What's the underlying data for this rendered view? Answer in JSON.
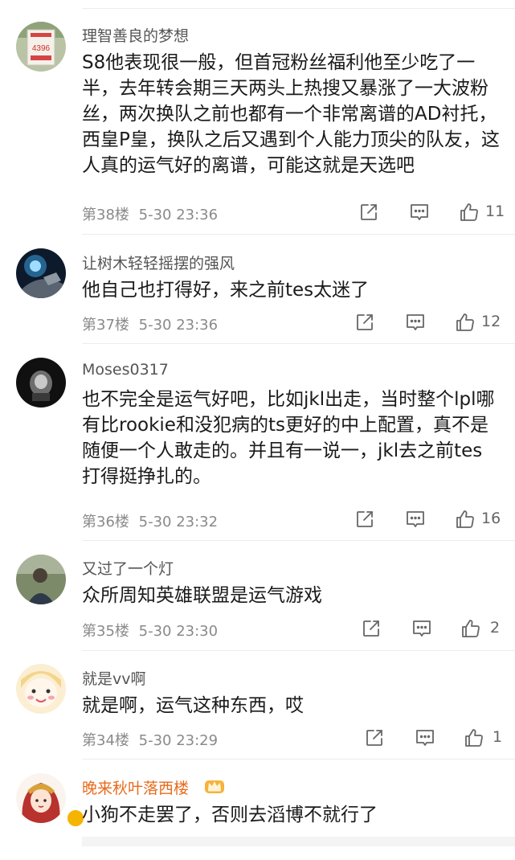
{
  "comments": [
    {
      "username": "理智善良的梦想",
      "text": "S8他表现很一般，但首冠粉丝福利他至少吃了一半，去年转会期三天两头上热搜又暴涨了一大波粉丝，两次换队之前也都有一个非常离谱的AD衬托，西皇P皇，换队之后又遇到个人能力顶尖的队友，这人真的运气好的离谱，可能这就是天选吧",
      "floor": "第38楼",
      "time": "5-30 23:36",
      "likes": "11",
      "avatar_text": "4396"
    },
    {
      "username": "让树木轻轻摇摆的强风",
      "text": "他自己也打得好，来之前tes太迷了",
      "floor": "第37楼",
      "time": "5-30 23:36",
      "likes": "12"
    },
    {
      "username": "Moses0317",
      "text": "也不完全是运气好吧，比如jkl出走，当时整个lpl哪有比rookie和没犯病的ts更好的中上配置，真不是随便一个人敢走的。并且有一说一，jkl去之前tes打得挺挣扎的。",
      "floor": "第36楼",
      "time": "5-30 23:32",
      "likes": "16"
    },
    {
      "username": "又过了一个灯",
      "text": "众所周知英雄联盟是运气游戏",
      "floor": "第35楼",
      "time": "5-30 23:30",
      "likes": "2"
    },
    {
      "username": "就是vv啊",
      "text": "就是啊，运气这种东西，哎",
      "floor": "第34楼",
      "time": "5-30 23:29",
      "likes": "1"
    },
    {
      "username": "晚来秋叶落西楼",
      "text": "小狗不走罢了，否则去滔博不就行了"
    }
  ],
  "icons": {
    "share": "share-icon",
    "reply": "comment-icon",
    "like": "thumbs-up-icon",
    "vip": "crown-badge-icon",
    "verified": "verified-badge-icon"
  },
  "colors": {
    "vip_name": "#e86b1c",
    "meta_text": "#8a8a8a",
    "divider": "#ececec"
  }
}
